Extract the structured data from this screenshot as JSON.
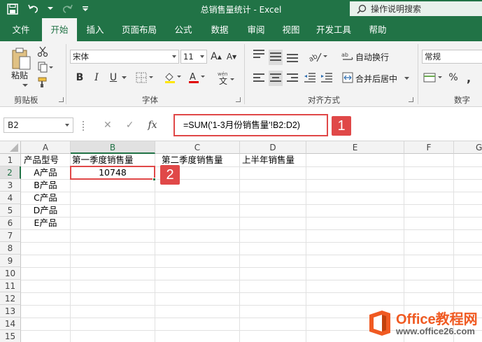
{
  "window": {
    "title": "总销售量统计  -  Excel",
    "tell_me": "操作说明搜索"
  },
  "tabs": [
    {
      "label": "文件"
    },
    {
      "label": "开始"
    },
    {
      "label": "插入"
    },
    {
      "label": "页面布局"
    },
    {
      "label": "公式"
    },
    {
      "label": "数据"
    },
    {
      "label": "审阅"
    },
    {
      "label": "视图"
    },
    {
      "label": "开发工具"
    },
    {
      "label": "帮助"
    }
  ],
  "ribbon": {
    "clipboard": {
      "label": "剪贴板",
      "paste_label": "粘贴"
    },
    "font": {
      "label": "字体",
      "font_name": "宋体",
      "font_size": "11",
      "grow": "A",
      "shrink": "A",
      "bold": "B",
      "italic": "I",
      "underline": "U"
    },
    "alignment": {
      "label": "对齐方式",
      "wrap_text": "自动换行",
      "merge_center": "合并后居中"
    },
    "number": {
      "label": "数字",
      "format": "常规",
      "percent": "%",
      "comma": ","
    }
  },
  "formula_bar": {
    "name_box": "B2",
    "cancel": "✕",
    "enter": "✓",
    "fx": "fx",
    "formula": "=SUM('1-3月份销售量'!B2:D2)"
  },
  "annotations": {
    "badge1": "1",
    "badge2": "2"
  },
  "grid": {
    "columns": [
      "A",
      "B",
      "C",
      "D",
      "E",
      "F",
      "G"
    ],
    "rows": [
      "1",
      "2",
      "3",
      "4",
      "5",
      "6",
      "7",
      "8",
      "9",
      "10",
      "11",
      "12",
      "13",
      "14",
      "15"
    ],
    "cells": {
      "A1": "产品型号",
      "B1": "第一季度销售量",
      "C1": "第二季度销售量",
      "D1": "上半年销售量",
      "A2": "A产品",
      "B2": "10748",
      "A3": "B产品",
      "A4": "C产品",
      "A5": "D产品",
      "A6": "E产品"
    }
  },
  "watermark": {
    "brand": "Office教程网",
    "url": "www.office26.com"
  },
  "colors": {
    "excel_green": "#217346",
    "highlight_red": "#e04848",
    "logo_orange": "#f05a22"
  }
}
